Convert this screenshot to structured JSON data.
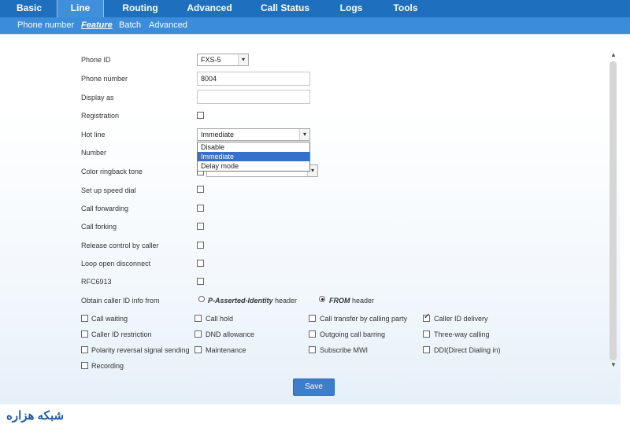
{
  "top_nav": {
    "tabs": [
      {
        "label": "Basic"
      },
      {
        "label": "Line"
      },
      {
        "label": "Routing"
      },
      {
        "label": "Advanced"
      },
      {
        "label": "Call Status"
      },
      {
        "label": "Logs"
      },
      {
        "label": "Tools"
      }
    ],
    "active_tab": "Line"
  },
  "sub_nav": {
    "items": [
      {
        "label": "Phone number"
      },
      {
        "label": "Feature"
      },
      {
        "label": "Batch"
      },
      {
        "label": "Advanced"
      }
    ],
    "active_item": "Feature"
  },
  "form": {
    "phone_id": {
      "label": "Phone ID",
      "value": "FXS-5"
    },
    "phone_number": {
      "label": "Phone number",
      "value": "8004"
    },
    "display_as": {
      "label": "Display as",
      "value": ""
    },
    "registration": {
      "label": "Registration",
      "checked": false
    },
    "hot_line": {
      "label": "Hot line",
      "value": "Immediate",
      "options": [
        "Disable",
        "Immediate",
        "Delay mode"
      ],
      "highlighted": "Immediate"
    },
    "number": {
      "label": "Number"
    },
    "color_ringback_tone": {
      "label": "Color ringback tone",
      "checked": false
    },
    "speed_dial": {
      "label": "Set up speed dial",
      "checked": false
    },
    "call_forwarding": {
      "label": "Call forwarding",
      "checked": false
    },
    "call_forking": {
      "label": "Call forking",
      "checked": false
    },
    "release_control": {
      "label": "Release control by caller",
      "checked": false
    },
    "loop_open": {
      "label": "Loop open disconnect",
      "checked": false
    },
    "rfc6913": {
      "label": "RFC6913",
      "checked": false
    },
    "caller_id_from": {
      "label": "Obtain caller ID info from",
      "option1_bold": "P-Asserted-Identity",
      "option1_rest": " header",
      "option2_bold": "FROM",
      "option2_rest": " header",
      "selected": "FROM"
    }
  },
  "options_grid": [
    {
      "label": "Call waiting",
      "checked": false
    },
    {
      "label": "Call hold",
      "checked": false
    },
    {
      "label": "Call transfer by calling party",
      "checked": false
    },
    {
      "label": "Caller ID delivery",
      "checked": true
    },
    {
      "label": "Caller ID restriction",
      "checked": false
    },
    {
      "label": "DND allowance",
      "checked": false
    },
    {
      "label": "Outgoing call barring",
      "checked": false
    },
    {
      "label": "Three-way calling",
      "checked": false
    },
    {
      "label": "Polarity reversal signal sending",
      "checked": false
    },
    {
      "label": "Maintenance",
      "checked": false
    },
    {
      "label": "Subscribe MWI",
      "checked": false
    },
    {
      "label": "DDI(Direct Dialing in)",
      "checked": false
    },
    {
      "label": "Recording",
      "checked": false
    }
  ],
  "save_button": {
    "label": "Save"
  },
  "watermark": {
    "text": "شبکه هزاره"
  }
}
